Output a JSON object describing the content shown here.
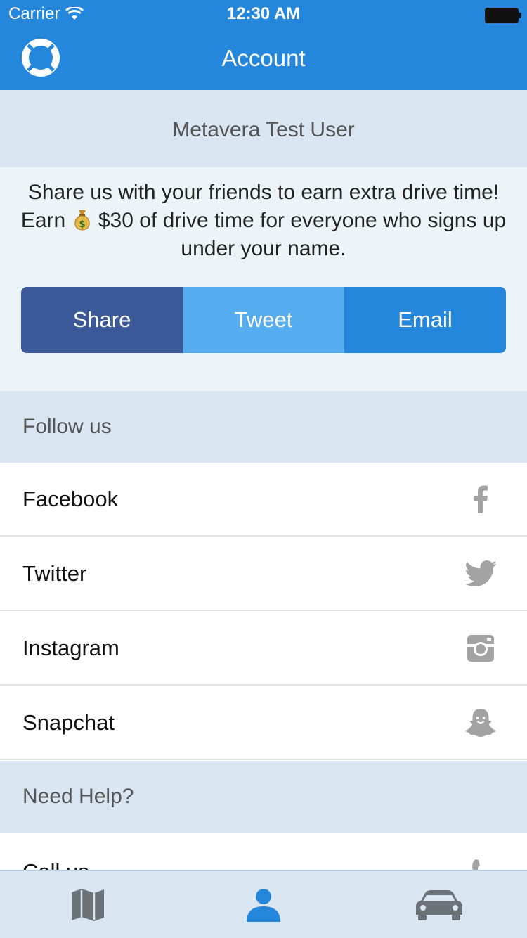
{
  "status": {
    "carrier": "Carrier",
    "time": "12:30 AM"
  },
  "nav": {
    "title": "Account"
  },
  "user": {
    "name": "Metavera Test User"
  },
  "promo": {
    "line1": "Share us with your friends to earn extra drive time!",
    "line2_prefix": "Earn",
    "line2_suffix": "$30 of drive time for everyone who signs up under your name.",
    "buttons": {
      "share": "Share",
      "tweet": "Tweet",
      "email": "Email"
    }
  },
  "follow": {
    "header": "Follow us",
    "items": [
      {
        "label": "Facebook",
        "icon": "facebook-icon"
      },
      {
        "label": "Twitter",
        "icon": "twitter-icon"
      },
      {
        "label": "Instagram",
        "icon": "instagram-icon"
      },
      {
        "label": "Snapchat",
        "icon": "snapchat-icon"
      }
    ]
  },
  "help": {
    "header": "Need Help?",
    "items": [
      {
        "label": "Call us",
        "icon": "phone-icon"
      }
    ]
  },
  "tabs": [
    {
      "name": "map",
      "icon": "map-icon",
      "active": false
    },
    {
      "name": "account",
      "icon": "person-icon",
      "active": true
    },
    {
      "name": "car",
      "icon": "car-icon",
      "active": false
    }
  ],
  "colors": {
    "nav_blue": "#2487dc",
    "facebook": "#3b5998",
    "twitter": "#55acee",
    "section_bg": "#d9e6f2",
    "icon_gray": "#a3a3a3",
    "tab_icon_gray": "#6b7378"
  }
}
